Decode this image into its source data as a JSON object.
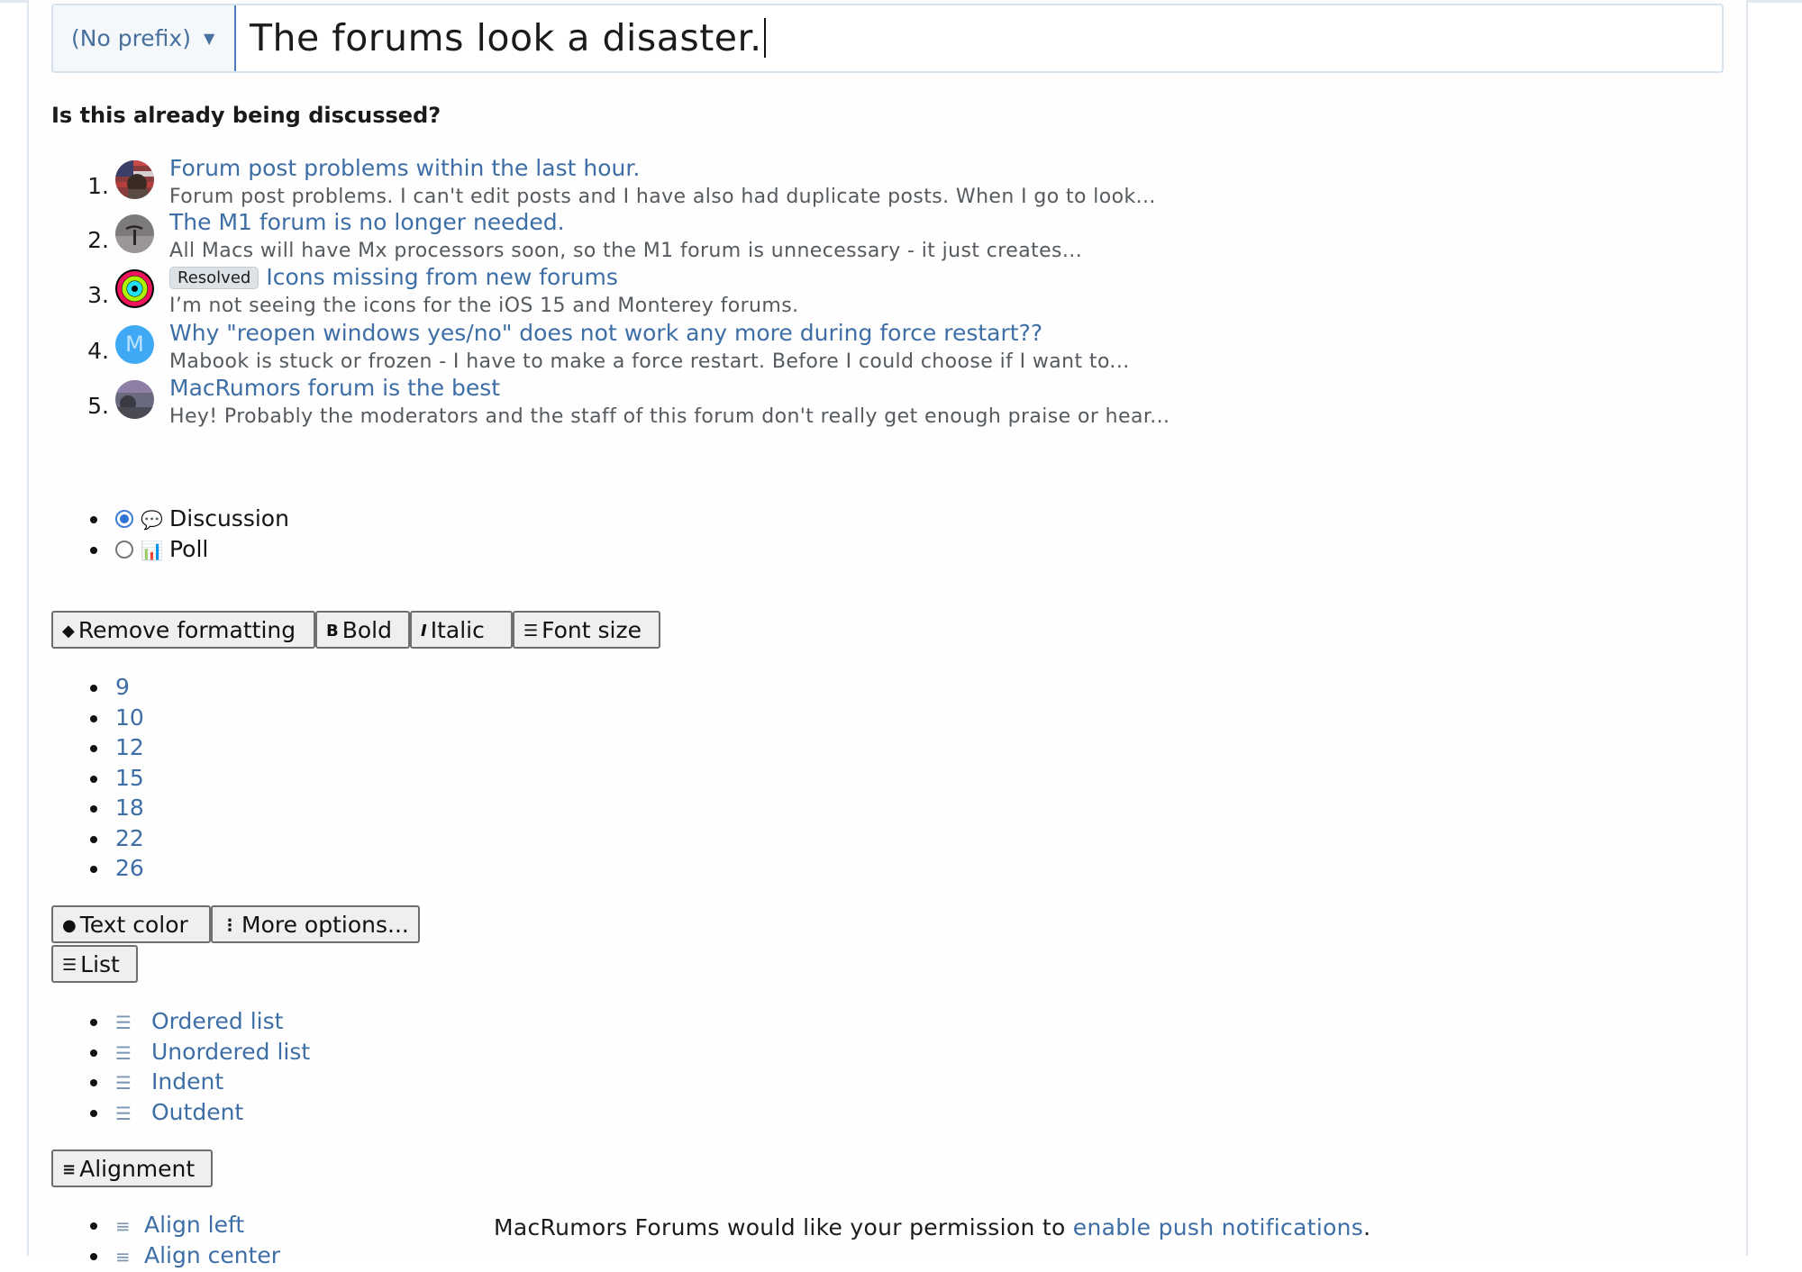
{
  "title": {
    "prefix": "(No prefix)",
    "value": "The forums look a disaster."
  },
  "similar": {
    "heading": "Is this already being discussed?",
    "threads": [
      {
        "num": "1.",
        "title": "Forum post problems within the last hour.",
        "snippet": "Forum post problems. I can't edit posts and I have also had duplicate posts. When I go to look..."
      },
      {
        "num": "2.",
        "title": "The M1 forum is no longer needed.",
        "snippet": "All Macs will have Mx processors soon, so the M1 forum is unnecessary - it just creates..."
      },
      {
        "num": "3.",
        "badge": "Resolved",
        "title": "Icons missing from new forums",
        "snippet": "I’m not seeing the icons for the iOS 15 and Monterey forums."
      },
      {
        "num": "4.",
        "avatar_letter": "M",
        "title": "Why \"reopen windows yes/no\" does not work any more during force restart??",
        "snippet": "Mabook is stuck or frozen - I have to make a force restart. Before I could choose if I want to..."
      },
      {
        "num": "5.",
        "title": "MacRumors forum is the best",
        "snippet": "Hey! Probably the moderators and the staff of this forum don't really get enough praise or hear..."
      }
    ]
  },
  "thread_type": {
    "options": [
      {
        "label": "Discussion",
        "icon": "speech-bubbles-icon",
        "selected": true
      },
      {
        "label": "Poll",
        "icon": "bar-chart-icon",
        "selected": false
      }
    ]
  },
  "toolbar": {
    "remove_formatting": "Remove formatting",
    "bold": "Bold",
    "italic": "Italic",
    "font_size": "Font size",
    "text_color": "Text color",
    "more_options": "More options...",
    "list": "List",
    "alignment": "Alignment"
  },
  "font_sizes": [
    "9",
    "10",
    "12",
    "15",
    "18",
    "22",
    "26"
  ],
  "list_options": [
    "Ordered list",
    "Unordered list",
    "Indent",
    "Outdent"
  ],
  "align_options": [
    "Align left",
    "Align center"
  ],
  "push_notice": {
    "prefix": "MacRumors Forums would like your permission to ",
    "link": "enable push notifications",
    "suffix": "."
  },
  "colors": {
    "link": "#3d6ea6",
    "radio_selected": "#2f72d4",
    "avatar_m": "#3fa9f5"
  }
}
